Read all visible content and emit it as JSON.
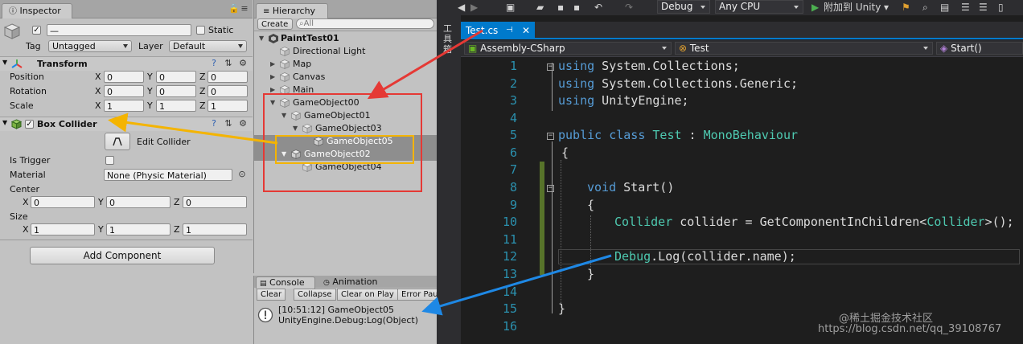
{
  "inspector": {
    "tab_label": "Inspector",
    "object_name_value": "—",
    "static_label": "Static",
    "tag_label": "Tag",
    "tag_value": "Untagged",
    "layer_label": "Layer",
    "layer_value": "Default",
    "transform": {
      "title": "Transform",
      "position_label": "Position",
      "rotation_label": "Rotation",
      "scale_label": "Scale",
      "axis_x": "X",
      "axis_y": "Y",
      "axis_z": "Z",
      "position": [
        "0",
        "0",
        "0"
      ],
      "rotation": [
        "0",
        "0",
        "0"
      ],
      "scale": [
        "1",
        "1",
        "1"
      ]
    },
    "box_collider": {
      "title": "Box Collider",
      "edit_collider_label": "Edit Collider",
      "is_trigger_label": "Is Trigger",
      "material_label": "Material",
      "material_value": "None (Physic Material)",
      "center_label": "Center",
      "center": [
        "0",
        "0",
        "0"
      ],
      "size_label": "Size",
      "size": [
        "1",
        "1",
        "1"
      ]
    },
    "add_component_label": "Add Component"
  },
  "hierarchy": {
    "tab_label": "Hierarchy",
    "create_label": "Create",
    "search_placeholder": "All",
    "scene_name": "PaintTest01",
    "items": [
      {
        "label": "Directional Light"
      },
      {
        "label": "Map"
      },
      {
        "label": "Canvas"
      },
      {
        "label": "Main"
      },
      {
        "label": "GameObject00"
      },
      {
        "label": "GameObject01"
      },
      {
        "label": "GameObject03"
      },
      {
        "label": "GameObject05"
      },
      {
        "label": "GameObject02"
      },
      {
        "label": "GameObject04"
      }
    ]
  },
  "console": {
    "tab_label": "Console",
    "animation_tab_label": "Animation",
    "clear_label": "Clear",
    "collapse_label": "Collapse",
    "clear_on_play_label": "Clear on Play",
    "error_pause_label": "Error Pau",
    "log_line1": "[10:51:12] GameObject05",
    "log_line2": "UnityEngine.Debug:Log(Object)"
  },
  "vs": {
    "config_value": "Debug",
    "platform_value": "Any CPU",
    "attach_label": "附加到 Unity",
    "side_label": "工具箱",
    "file_tab_label": "Test.cs",
    "nav_project": "Assembly-CSharp",
    "nav_class": "Test",
    "nav_member": "Start()",
    "code_lines": [
      {
        "n": "1"
      },
      {
        "n": "2"
      },
      {
        "n": "3"
      },
      {
        "n": "4"
      },
      {
        "n": "5"
      },
      {
        "n": "6"
      },
      {
        "n": "7"
      },
      {
        "n": "8"
      },
      {
        "n": "9"
      },
      {
        "n": "10"
      },
      {
        "n": "11"
      },
      {
        "n": "12"
      },
      {
        "n": "13"
      },
      {
        "n": "14"
      },
      {
        "n": "15"
      },
      {
        "n": "16"
      }
    ],
    "code": {
      "l1_kw": "using",
      "l1_rest": " System.Collections;",
      "l2_kw": "using",
      "l2_rest": " System.Collections.Generic;",
      "l3_kw": "using",
      "l3_rest": " UnityEngine;",
      "l5_kw": "public class",
      "l5_name": " Test",
      "l5_colon": " : ",
      "l5_base": "MonoBehaviour",
      "l6": "{",
      "l8_kw": "void",
      "l8_rest": " Start()",
      "l9": "{",
      "l10_type": "Collider",
      "l10_mid": " collider = GetComponentInChildren<",
      "l10_type2": "Collider",
      "l10_end": ">();",
      "l12_type": "Debug",
      "l12_rest": ".Log(collider.name);",
      "l13": "}",
      "l15": "}"
    },
    "watermark": "https://blog.csdn.net/qq_39108767",
    "watermark2": "@稀土掘金技术社区"
  },
  "colors": {
    "red_box": "#e53935",
    "yellow_box": "#f4b400",
    "blue_arrow": "#1e88e5",
    "vs_keyword": "#569cd6",
    "vs_type": "#4ec9b0",
    "vs_line_number": "#2b91af"
  }
}
